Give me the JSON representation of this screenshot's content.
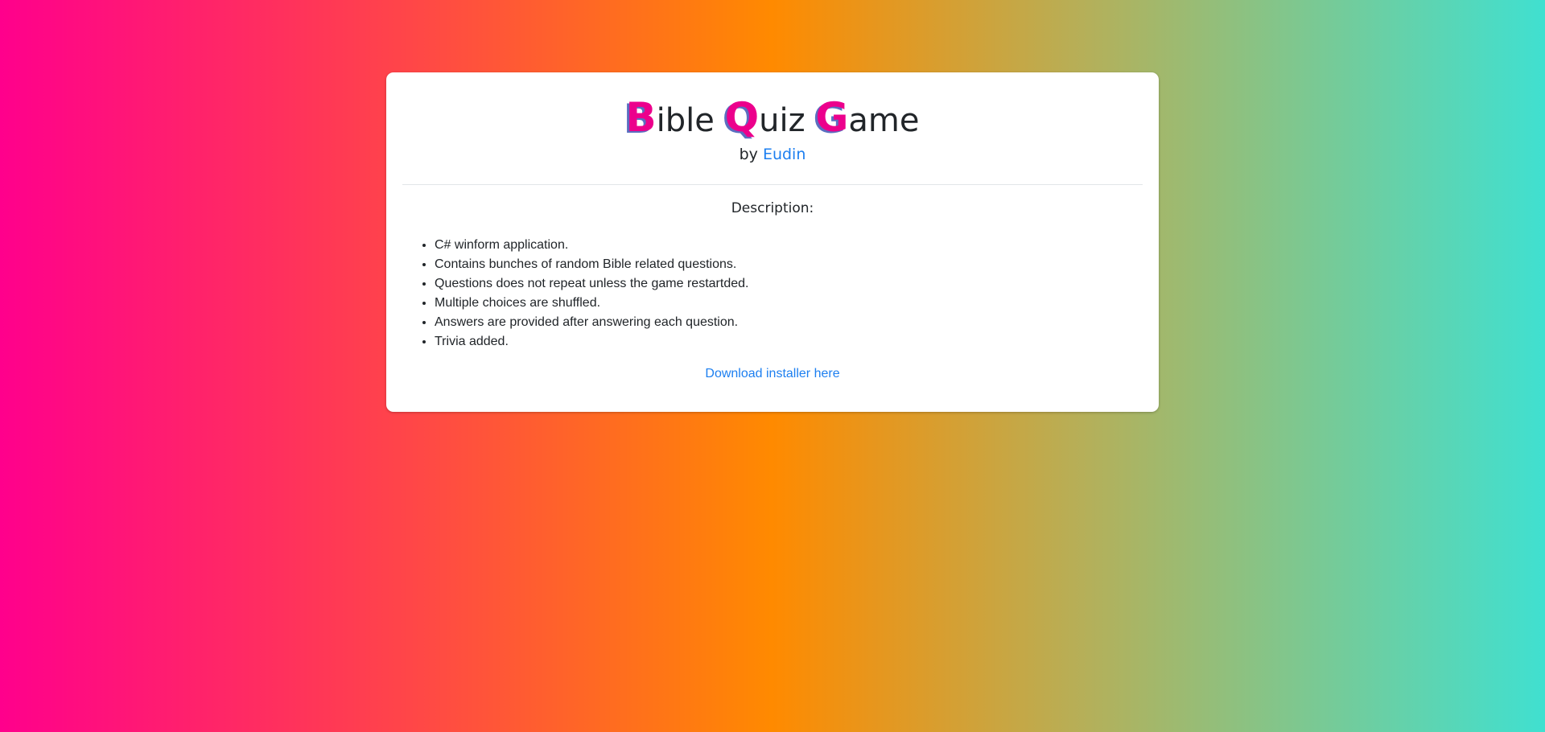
{
  "title": {
    "word1_initial": "B",
    "word1_rest": "ible",
    "word2_initial": "Q",
    "word2_rest": "uiz",
    "word3_initial": "G",
    "word3_rest": "ame"
  },
  "byline": {
    "prefix": "by",
    "author": "Eudin"
  },
  "description": {
    "heading": "Description:",
    "items": [
      "C# winform application.",
      "Contains bunches of random Bible related questions.",
      "Questions does not repeat unless the game restartded.",
      "Multiple choices are shuffled.",
      "Answers are provided after answering each question.",
      "Trivia added."
    ]
  },
  "download": {
    "label": "Download installer here"
  },
  "colors": {
    "accent_initials": "#ec008c",
    "initials_shadow": "#5a6ec0",
    "link": "#1d7ff0",
    "text": "#212529",
    "card_background": "#ffffff",
    "gradient": [
      "#ff008c",
      "#ff4a44",
      "#ff8a00",
      "#b6af58",
      "#86c487",
      "#40e0d0"
    ]
  }
}
